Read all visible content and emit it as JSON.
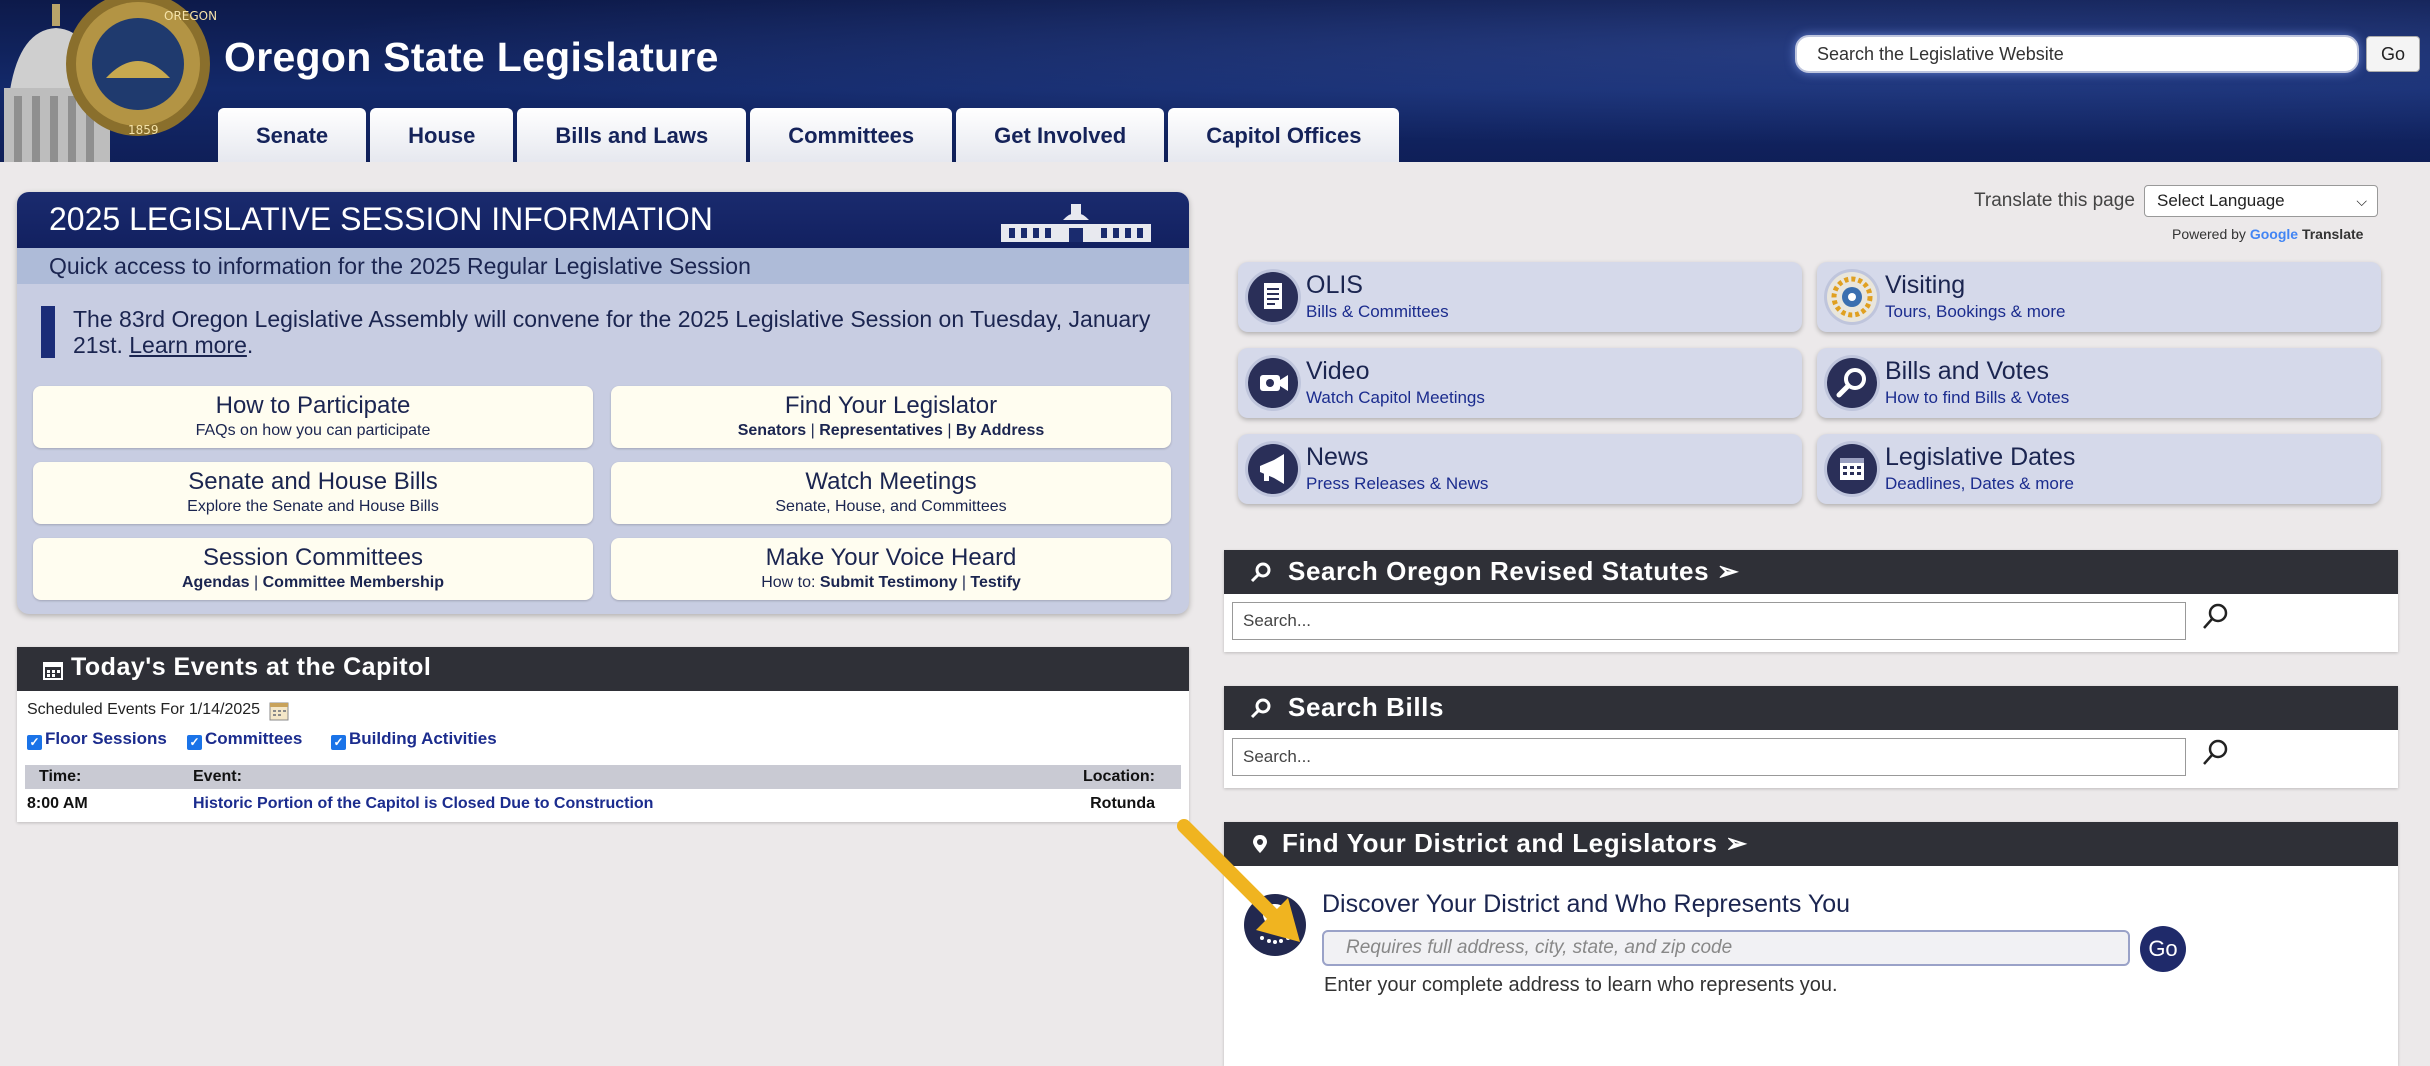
{
  "header": {
    "site_title": "Oregon State Legislature",
    "seal_lettering": [
      "OREGON",
      "1859"
    ],
    "search_placeholder": "Search the Legislative Website",
    "search_go": "Go"
  },
  "nav": {
    "tabs": [
      {
        "label": "Senate"
      },
      {
        "label": "House"
      },
      {
        "label": "Bills and Laws"
      },
      {
        "label": "Committees"
      },
      {
        "label": "Get Involved"
      },
      {
        "label": "Capitol Offices"
      }
    ]
  },
  "session": {
    "title": "2025 LEGISLATIVE SESSION INFORMATION",
    "subtitle": "Quick access to information for the 2025 Regular Legislative Session",
    "notice_text": "The 83rd Oregon Legislative Assembly will convene for the 2025 Legislative Session on Tuesday, January 21st. ",
    "notice_link": "Learn more",
    "notice_end": ".",
    "buttons": {
      "participate": {
        "title": "How to Participate",
        "sub": "FAQs on how you can participate"
      },
      "legislator": {
        "title": "Find Your Legislator",
        "links": [
          "Senators",
          "Representatives",
          "By Address"
        ],
        "sep": " | "
      },
      "bills": {
        "title": "Senate and House Bills",
        "sub": "Explore the Senate and House Bills"
      },
      "meetings": {
        "title": "Watch Meetings",
        "sub": "Senate, House, and Committees"
      },
      "committees": {
        "title": "Session Committees",
        "links": [
          "Agendas",
          "Committee Membership"
        ],
        "sep": " | "
      },
      "voice": {
        "title": "Make Your Voice Heard",
        "prefix": "How to: ",
        "links": [
          "Submit Testimony",
          "Testify"
        ],
        "sep": " | "
      }
    }
  },
  "events": {
    "title": "Today's Events at the Capitol",
    "scheduled_label": "Scheduled Events For 1/14/2025",
    "filters": [
      "Floor Sessions",
      "Committees",
      "Building Activities"
    ],
    "columns": {
      "time": "Time:",
      "event": "Event:",
      "location": "Location:"
    },
    "rows": [
      {
        "time": "8:00 AM",
        "event": "Historic Portion of the Capitol is Closed Due to Construction",
        "location": "Rotunda"
      }
    ]
  },
  "translate": {
    "label": "Translate this page",
    "select_value": "Select Language",
    "powered_by": "Powered by",
    "google": "Google",
    "translate_word": "Translate"
  },
  "tiles": [
    {
      "title": "OLIS",
      "sub": "Bills & Committees",
      "icon": "document-icon"
    },
    {
      "title": "Visiting",
      "sub": "Tours, Bookings & more",
      "icon": "compass-icon"
    },
    {
      "title": "Video",
      "sub": "Watch Capitol Meetings",
      "icon": "video-camera-icon"
    },
    {
      "title": "Bills and Votes",
      "sub": "How to find Bills & Votes",
      "icon": "magnifier-icon"
    },
    {
      "title": "News",
      "sub": "Press Releases & News",
      "icon": "megaphone-icon"
    },
    {
      "title": "Legislative Dates",
      "sub": "Deadlines, Dates & more",
      "icon": "calendar-icon"
    }
  ],
  "statutes": {
    "title": "Search Oregon Revised Statutes ➢",
    "placeholder": "Search..."
  },
  "bills_search": {
    "title": "Search Bills",
    "placeholder": "Search..."
  },
  "district": {
    "title": "Find Your District and Legislators ➢",
    "heading": "Discover Your District and Who Represents You",
    "placeholder": "Requires full address, city, state, and zip code",
    "go": "Go",
    "hint": "Enter your complete address to learn who represents you."
  },
  "colors": {
    "navy": "#13296a",
    "dark_bar": "#2f3037",
    "accent_arrow": "#f0b420"
  }
}
